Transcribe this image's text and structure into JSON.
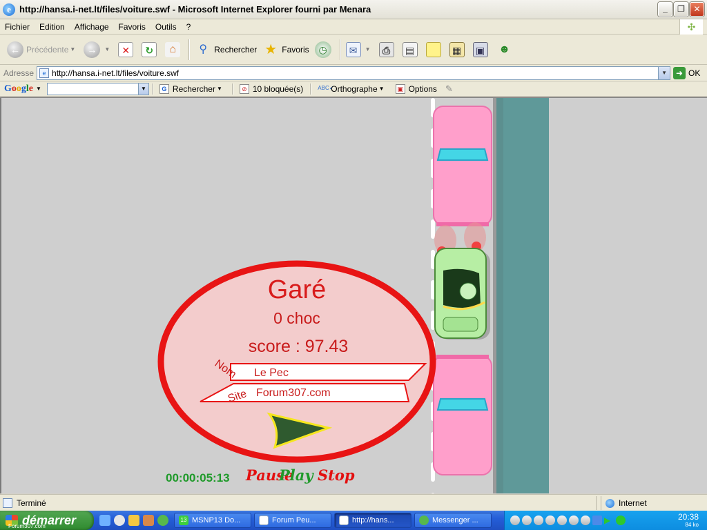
{
  "window": {
    "title": "http://hansa.i-net.lt/files/voiture.swf - Microsoft Internet Explorer fourni par Menara"
  },
  "menu": [
    "Fichier",
    "Edition",
    "Affichage",
    "Favoris",
    "Outils",
    "?"
  ],
  "toolbar": {
    "back_label": "Précédente",
    "search_label": "Rechercher",
    "favorites_label": "Favoris"
  },
  "address": {
    "label": "Adresse",
    "url": "http://hansa.i-net.lt/files/voiture.swf",
    "go_label": "OK"
  },
  "googlebar": {
    "search_label": "Rechercher",
    "blocked_label": "10 bloquée(s)",
    "spell_label": "Orthographe",
    "options_label": "Options"
  },
  "game": {
    "result_title": "Garé",
    "shock_text": "0 choc",
    "score_text": "score : 97.43",
    "nom_label": "Nom",
    "site_label": "Site",
    "nom_value": "Le Pec",
    "site_value": "Forum307.com",
    "timer": "00:00:05:13",
    "pause_label": "Pause",
    "play_label": "Play",
    "stop_label": "Stop",
    "colors": {
      "ellipse_fill": "#f3cccc",
      "ellipse_stroke": "#e81414",
      "parked_car": "#ff9fcb",
      "player_car": "#b7eea4",
      "water": "#5f9999",
      "road": "#cfcfcf"
    }
  },
  "status": {
    "text": "Terminé",
    "zone": "Internet"
  },
  "taskbar": {
    "start_label": "démarrer",
    "start_watermark": "Forum307.com",
    "tasks": [
      "MSNP13 Do...",
      "Forum Peu...",
      "http://hans...",
      "Messenger ..."
    ],
    "msn_badge": "13",
    "clock": "20:38",
    "kb": "84 ko"
  }
}
